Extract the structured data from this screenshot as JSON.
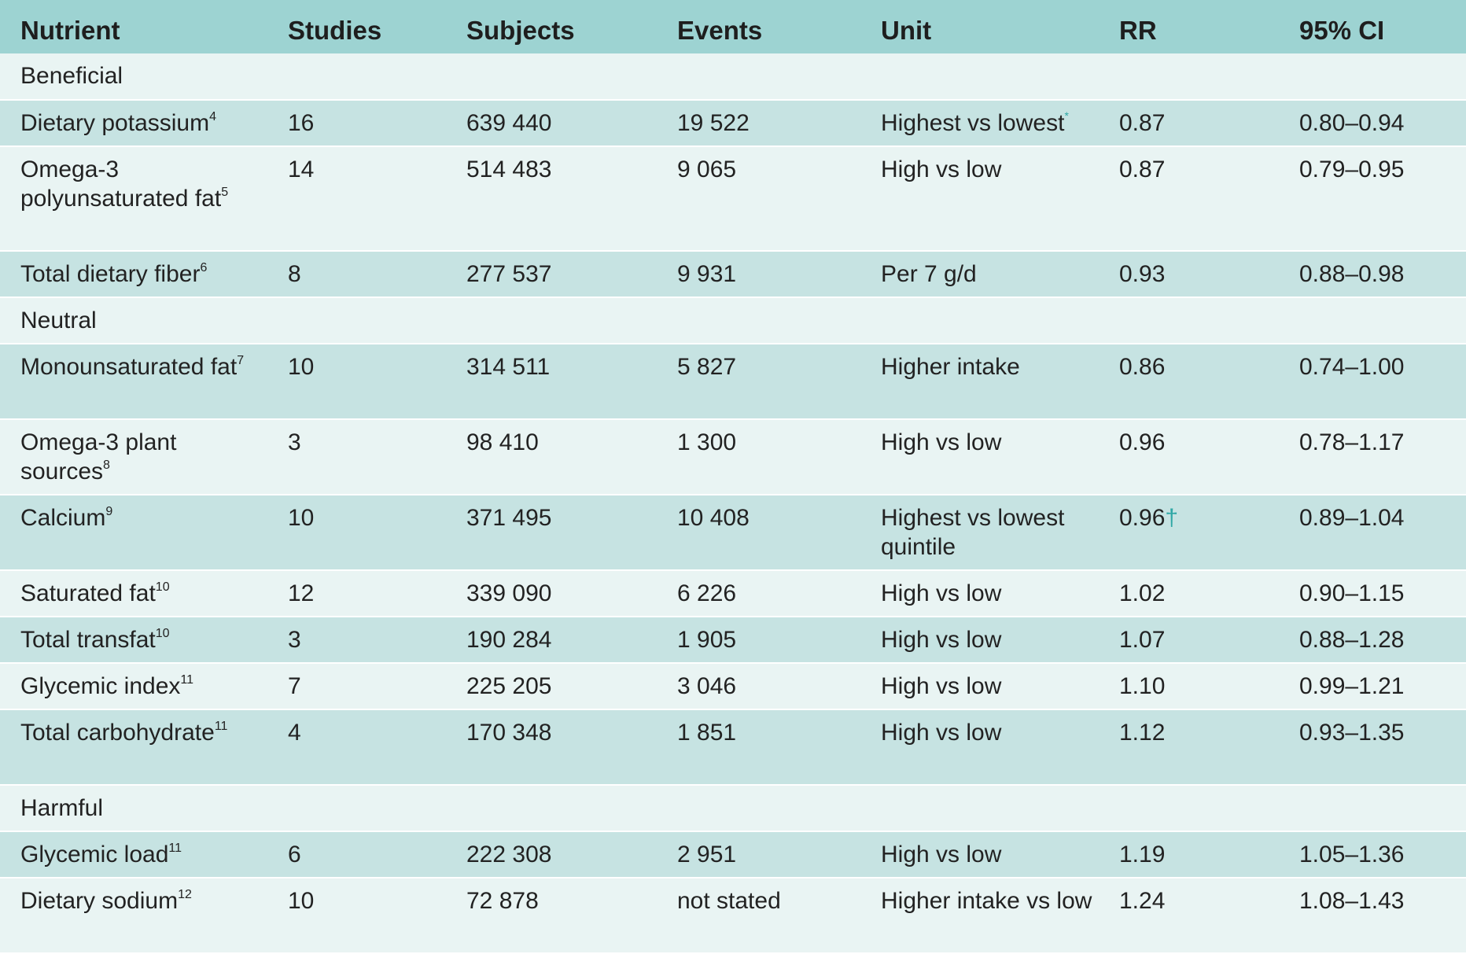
{
  "table": {
    "headers": [
      "Nutrient",
      "Studies",
      "Subjects",
      "Events",
      "Unit",
      "RR",
      "95% CI"
    ],
    "groups": {
      "beneficial": "Beneficial",
      "neutral": "Neutral",
      "harmful": "Harmful"
    },
    "rows": [
      {
        "nutrient": "Dietary potassium",
        "ref": "4",
        "studies": "16",
        "subjects": "639 440",
        "events": "19 522",
        "unit": "Highest vs lowest",
        "unit_mark": "*",
        "rr": "0.87",
        "rr_mark": "",
        "ci": "0.80–0.94"
      },
      {
        "nutrient": "Omega-3 polyunsaturated fat",
        "ref": "5",
        "studies": "14",
        "subjects": "514 483",
        "events": "9 065",
        "unit": "High vs low",
        "unit_mark": "",
        "rr": "0.87",
        "rr_mark": "",
        "ci": "0.79–0.95"
      },
      {
        "nutrient": "Total dietary fiber",
        "ref": "6",
        "studies": "8",
        "subjects": "277 537",
        "events": "9 931",
        "unit": "Per 7 g/d",
        "unit_mark": "",
        "rr": "0.93",
        "rr_mark": "",
        "ci": "0.88–0.98"
      },
      {
        "nutrient": "Monounsaturated fat",
        "ref": "7",
        "studies": "10",
        "subjects": "314 511",
        "events": "5 827",
        "unit": "Higher intake",
        "unit_mark": "",
        "rr": "0.86",
        "rr_mark": "",
        "ci": "0.74–1.00"
      },
      {
        "nutrient": "Omega-3 plant sources",
        "ref": "8",
        "studies": "3",
        "subjects": "98 410",
        "events": "1 300",
        "unit": "High vs low",
        "unit_mark": "",
        "rr": "0.96",
        "rr_mark": "",
        "ci": "0.78–1.17"
      },
      {
        "nutrient": "Calcium",
        "ref": "9",
        "studies": "10",
        "subjects": "371 495",
        "events": "10 408",
        "unit": "Highest vs lowest quintile",
        "unit_mark": "",
        "rr": "0.96",
        "rr_mark": "†",
        "ci": "0.89–1.04"
      },
      {
        "nutrient": "Saturated fat",
        "ref": "10",
        "studies": "12",
        "subjects": "339 090",
        "events": "6 226",
        "unit": "High vs low",
        "unit_mark": "",
        "rr": "1.02",
        "rr_mark": "",
        "ci": "0.90–1.15"
      },
      {
        "nutrient": "Total transfat",
        "ref": "10",
        "studies": "3",
        "subjects": "190 284",
        "events": "1 905",
        "unit": "High vs low",
        "unit_mark": "",
        "rr": "1.07",
        "rr_mark": "",
        "ci": "0.88–1.28"
      },
      {
        "nutrient": "Glycemic index",
        "ref": "11",
        "studies": "7",
        "subjects": "225 205",
        "events": "3 046",
        "unit": "High vs low",
        "unit_mark": "",
        "rr": "1.10",
        "rr_mark": "",
        "ci": "0.99–1.21"
      },
      {
        "nutrient": "Total carbohydrate",
        "ref": "11",
        "studies": "4",
        "subjects": "170 348",
        "events": "1 851",
        "unit": "High vs low",
        "unit_mark": "",
        "rr": "1.12",
        "rr_mark": "",
        "ci": "0.93–1.35"
      },
      {
        "nutrient": "Glycemic load",
        "ref": "11",
        "studies": "6",
        "subjects": "222 308",
        "events": "2 951",
        "unit": "High vs low",
        "unit_mark": "",
        "rr": "1.19",
        "rr_mark": "",
        "ci": "1.05–1.36"
      },
      {
        "nutrient": "Dietary sodium",
        "ref": "12",
        "studies": "10",
        "subjects": "72 878",
        "events": "not stated",
        "unit": "Higher intake vs low",
        "unit_mark": "",
        "rr": "1.24",
        "rr_mark": "",
        "ci": "1.08–1.43"
      }
    ]
  }
}
